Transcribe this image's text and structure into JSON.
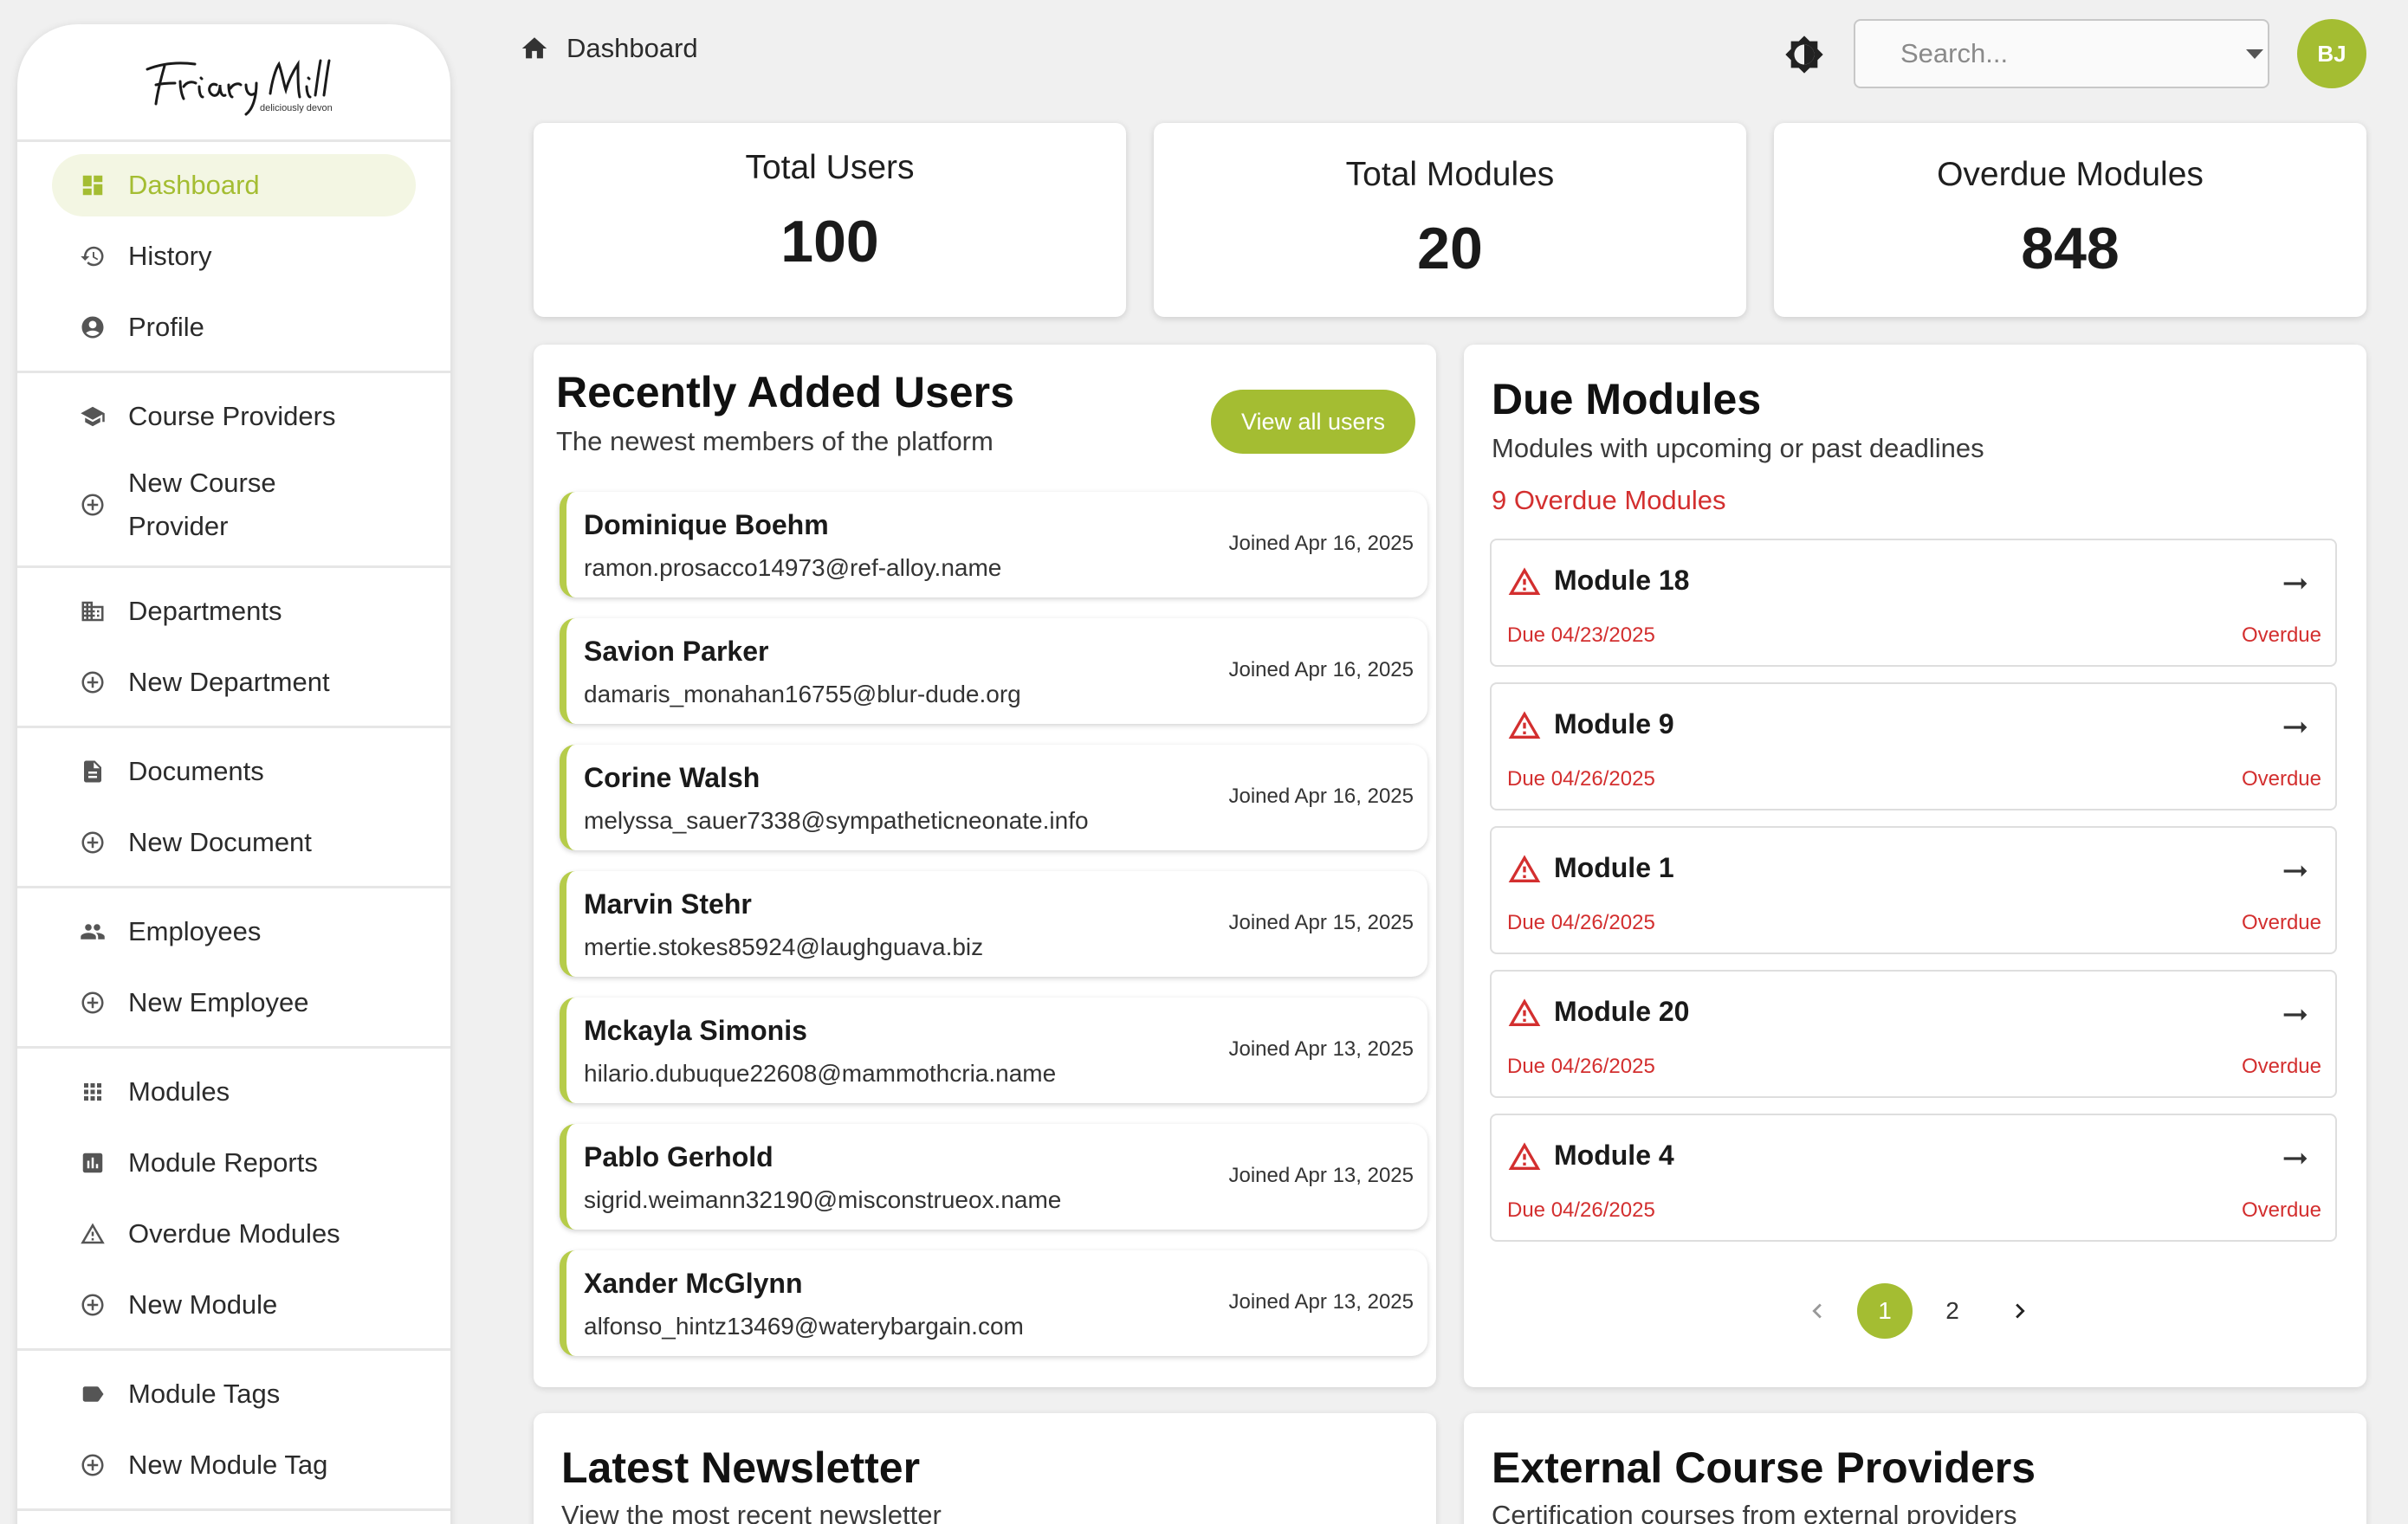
{
  "brand": {
    "logo_text": "Friary Mill",
    "logo_tagline": "deliciously devon"
  },
  "sidebar": {
    "groups": [
      {
        "items": [
          {
            "label": "Dashboard",
            "icon": "dashboard-icon",
            "active": true
          },
          {
            "label": "History",
            "icon": "history-icon"
          },
          {
            "label": "Profile",
            "icon": "account-circle-icon"
          }
        ]
      },
      {
        "items": [
          {
            "label": "Course Providers",
            "icon": "school-icon"
          },
          {
            "label": "New Course Provider",
            "icon": "add-circle-icon"
          }
        ]
      },
      {
        "items": [
          {
            "label": "Departments",
            "icon": "business-icon"
          },
          {
            "label": "New Department",
            "icon": "add-circle-icon"
          }
        ]
      },
      {
        "items": [
          {
            "label": "Documents",
            "icon": "description-icon"
          },
          {
            "label": "New Document",
            "icon": "add-circle-icon"
          }
        ]
      },
      {
        "items": [
          {
            "label": "Employees",
            "icon": "people-icon"
          },
          {
            "label": "New Employee",
            "icon": "add-circle-icon"
          }
        ]
      },
      {
        "items": [
          {
            "label": "Modules",
            "icon": "apps-icon"
          },
          {
            "label": "Module Reports",
            "icon": "assessment-icon"
          },
          {
            "label": "Overdue Modules",
            "icon": "warning-icon"
          },
          {
            "label": "New Module",
            "icon": "add-circle-icon"
          }
        ]
      },
      {
        "items": [
          {
            "label": "Module Tags",
            "icon": "label-icon"
          },
          {
            "label": "New Module Tag",
            "icon": "add-circle-icon"
          }
        ]
      }
    ]
  },
  "header": {
    "breadcrumb": "Dashboard",
    "search_placeholder": "Search...",
    "avatar_initials": "BJ"
  },
  "stats": [
    {
      "label": "Total Users",
      "value": "100"
    },
    {
      "label": "Total Modules",
      "value": "20"
    },
    {
      "label": "Overdue Modules",
      "value": "848"
    }
  ],
  "recent_users": {
    "title": "Recently Added Users",
    "subtitle": "The newest members of the platform",
    "view_all_label": "View all users",
    "users": [
      {
        "name": "Dominique Boehm",
        "email": "ramon.prosacco14973@ref-alloy.name",
        "joined": "Joined Apr 16, 2025"
      },
      {
        "name": "Savion Parker",
        "email": "damaris_monahan16755@blur-dude.org",
        "joined": "Joined Apr 16, 2025"
      },
      {
        "name": "Corine Walsh",
        "email": "melyssa_sauer7338@sympatheticneonate.info",
        "joined": "Joined Apr 16, 2025"
      },
      {
        "name": "Marvin Stehr",
        "email": "mertie.stokes85924@laughguava.biz",
        "joined": "Joined Apr 15, 2025"
      },
      {
        "name": "Mckayla Simonis",
        "email": "hilario.dubuque22608@mammothcria.name",
        "joined": "Joined Apr 13, 2025"
      },
      {
        "name": "Pablo Gerhold",
        "email": "sigrid.weimann32190@misconstrueox.name",
        "joined": "Joined Apr 13, 2025"
      },
      {
        "name": "Xander McGlynn",
        "email": "alfonso_hintz13469@waterybargain.com",
        "joined": "Joined Apr 13, 2025"
      }
    ]
  },
  "due_modules": {
    "title": "Due Modules",
    "subtitle": "Modules with upcoming or past deadlines",
    "overdue_count_label": "9 Overdue Modules",
    "modules": [
      {
        "name": "Module 18",
        "due": "Due 04/23/2025",
        "status": "Overdue"
      },
      {
        "name": "Module 9",
        "due": "Due 04/26/2025",
        "status": "Overdue"
      },
      {
        "name": "Module 1",
        "due": "Due 04/26/2025",
        "status": "Overdue"
      },
      {
        "name": "Module 20",
        "due": "Due 04/26/2025",
        "status": "Overdue"
      },
      {
        "name": "Module 4",
        "due": "Due 04/26/2025",
        "status": "Overdue"
      }
    ],
    "pagination": {
      "pages": [
        "1",
        "2"
      ],
      "current": "1"
    }
  },
  "newsletter": {
    "title": "Latest Newsletter",
    "subtitle": "View the most recent newsletter"
  },
  "external_providers": {
    "title": "External Course Providers",
    "subtitle": "Certification courses from external providers"
  },
  "colors": {
    "accent": "#a4bd32",
    "danger": "#d32f2f",
    "background": "#f0f0f0"
  }
}
